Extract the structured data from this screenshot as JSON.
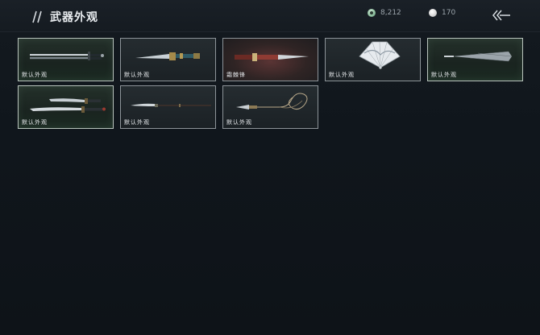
{
  "header": {
    "title": "武器外观",
    "jade_amount": "8,212",
    "pearl_amount": "170"
  },
  "weapons": [
    {
      "label": "默认外观",
      "icon": "long-sword-with-sheath-icon"
    },
    {
      "label": "默认外观",
      "icon": "ornate-dagger-icon"
    },
    {
      "label": "霜棘锋",
      "icon": "red-lacquered-dagger-icon"
    },
    {
      "label": "默认外观",
      "icon": "folding-fan-icon"
    },
    {
      "label": "默认外观",
      "icon": "closed-umbrella-icon"
    },
    {
      "label": "默认外观",
      "icon": "twin-blades-icon"
    },
    {
      "label": "默认外观",
      "icon": "glaive-icon"
    },
    {
      "label": "默认外观",
      "icon": "rope-dart-icon"
    }
  ],
  "colors": {
    "background": "#0f1419",
    "card_border": "#8d9499",
    "text": "#e6e9ec"
  }
}
